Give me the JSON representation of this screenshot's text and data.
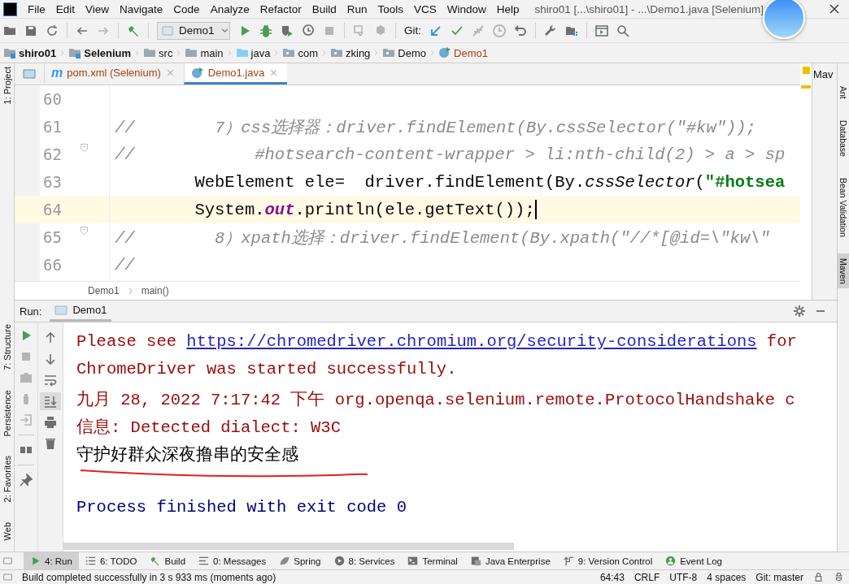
{
  "window": {
    "title": "shiro01 [...\\shiro01] - ...\\Demo1.java [Selenium]"
  },
  "menu": [
    "File",
    "Edit",
    "View",
    "Navigate",
    "Code",
    "Analyze",
    "Refactor",
    "Build",
    "Run",
    "Tools",
    "VCS",
    "Window",
    "Help"
  ],
  "toolbar": {
    "run_config": "Demo1",
    "git_label": "Git:"
  },
  "navigation": [
    {
      "label": "shiro01",
      "kind": "module"
    },
    {
      "label": "Selenium",
      "kind": "module"
    },
    {
      "label": "src",
      "kind": "folder"
    },
    {
      "label": "main",
      "kind": "folder"
    },
    {
      "label": "java",
      "kind": "source"
    },
    {
      "label": "com",
      "kind": "package"
    },
    {
      "label": "zking",
      "kind": "package"
    },
    {
      "label": "Demo",
      "kind": "package"
    },
    {
      "label": "Demo1",
      "kind": "class"
    }
  ],
  "left_tool_strip": {
    "top": [
      {
        "label": "1: Project",
        "selected": false
      }
    ],
    "bottom": [
      {
        "label": "7: Structure",
        "selected": false
      },
      {
        "label": "Persistence",
        "selected": false
      },
      {
        "label": "2: Favorites",
        "selected": false
      },
      {
        "label": "Web",
        "selected": false
      }
    ]
  },
  "right_tool_strip": [
    {
      "label": "Ant",
      "selected": false
    },
    {
      "label": "Database",
      "selected": false
    },
    {
      "label": "Bean Validation",
      "selected": false
    },
    {
      "label": "Maven",
      "selected": true
    }
  ],
  "editor_tabs": [
    {
      "kind": "maven",
      "icon_text": "m",
      "label": "pom.xml (Selenium)",
      "selected": false
    },
    {
      "kind": "class",
      "label": "Demo1.java",
      "selected": true
    }
  ],
  "maven_panel": {
    "label": "Mav"
  },
  "code_lines": [
    {
      "number": "60",
      "current": false,
      "fold": false
    },
    {
      "number": "61",
      "current": false,
      "fold": false,
      "segments": [
        {
          "kind": "comment",
          "text": "//        7）css选择器：driver.findElement(By.cssSelector(\"#kw\"));"
        }
      ]
    },
    {
      "number": "62",
      "current": false,
      "fold": true,
      "segments": [
        {
          "kind": "comment",
          "text": "//            #hotsearch-content-wrapper > li:nth-child(2) > a > sp"
        }
      ]
    },
    {
      "number": "63",
      "current": false,
      "fold": false,
      "segments": [
        {
          "kind": "plain",
          "text": "        WebElement ele=  driver.findElement(By."
        },
        {
          "kind": "method",
          "text": "cssSelector"
        },
        {
          "kind": "plain",
          "text": "("
        },
        {
          "kind": "string",
          "text": "\"#hotsea"
        }
      ]
    },
    {
      "number": "64",
      "current": true,
      "fold": false,
      "segments": [
        {
          "kind": "plain",
          "text": "        System."
        },
        {
          "kind": "field",
          "text": "out"
        },
        {
          "kind": "plain",
          "text": ".println(ele.getText());"
        }
      ]
    },
    {
      "number": "65",
      "current": false,
      "fold": true,
      "segments": [
        {
          "kind": "comment",
          "text": "//        8）xpath选择：driver.findElement(By.xpath(\"//*[@id=\\\"kw\\\""
        }
      ]
    },
    {
      "number": "66",
      "current": false,
      "fold": false,
      "segments": [
        {
          "kind": "comment",
          "text": "//"
        }
      ]
    }
  ],
  "editor_breadcrumb": [
    "Demo1",
    "main()"
  ],
  "run": {
    "label": "Run:",
    "tab": "Demo1"
  },
  "console_lines": [
    {
      "kind": "err",
      "segments": [
        {
          "kind": "text",
          "text": "Please see "
        },
        {
          "kind": "link",
          "text": "https://chromedriver.chromium.org/security-considerations"
        },
        {
          "kind": "text",
          "text": " for"
        }
      ]
    },
    {
      "kind": "err",
      "segments": [
        {
          "kind": "text",
          "text": "ChromeDriver was started successfully."
        }
      ]
    },
    {
      "kind": "err",
      "segments": [
        {
          "kind": "text",
          "text": "九月 28, 2022 7:17:42 下午 org.openqa.selenium.remote.ProtocolHandshake c"
        }
      ]
    },
    {
      "kind": "err",
      "segments": [
        {
          "kind": "text",
          "text": "信息: Detected dialect: W3C"
        }
      ]
    },
    {
      "kind": "out",
      "underlined": true,
      "segments": [
        {
          "kind": "text",
          "text": "守护好群众深夜撸串的安全感"
        }
      ]
    },
    {
      "kind": "blank"
    },
    {
      "kind": "system",
      "segments": [
        {
          "kind": "text",
          "text": "Process finished with exit code 0"
        }
      ]
    }
  ],
  "bottom_tools": [
    {
      "kind": "run",
      "label": "4: Run",
      "selected": true
    },
    {
      "kind": "todo",
      "label": "6: TODO",
      "selected": false
    },
    {
      "kind": "build",
      "label": "Build",
      "selected": false
    },
    {
      "kind": "messages",
      "label": "0: Messages",
      "selected": false
    },
    {
      "kind": "spring",
      "label": "Spring",
      "selected": false
    },
    {
      "kind": "services",
      "label": "8: Services",
      "selected": false
    },
    {
      "kind": "terminal",
      "label": "Terminal",
      "selected": false
    },
    {
      "kind": "enterprise",
      "label": "Java Enterprise",
      "selected": false
    },
    {
      "kind": "vcs",
      "label": "9: Version Control",
      "selected": false
    },
    {
      "kind": "log",
      "label": "Event Log",
      "selected": false
    }
  ],
  "status_bar": {
    "message": "Build completed successfully in 3 s 933 ms (moments ago)",
    "position": "64:43",
    "line_separator": "CRLF",
    "encoding": "UTF-8",
    "indent": "4 spaces",
    "vcs": "Git: master"
  }
}
